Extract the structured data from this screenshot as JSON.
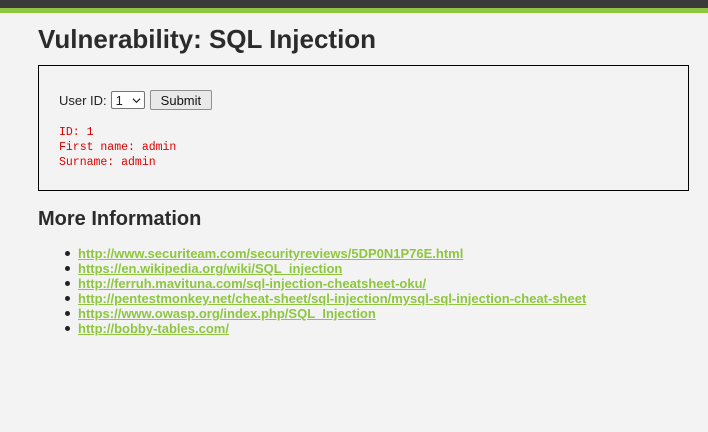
{
  "page": {
    "title": "Vulnerability: SQL Injection"
  },
  "form": {
    "user_id_label": "User ID:",
    "selected_value": "1",
    "submit_label": "Submit"
  },
  "result": {
    "id_line": "ID: 1",
    "first_name_line": "First name: admin",
    "surname_line": "Surname: admin"
  },
  "more_info": {
    "title": "More Information",
    "links": [
      "http://www.securiteam.com/securityreviews/5DP0N1P76E.html",
      "https://en.wikipedia.org/wiki/SQL_injection",
      "http://ferruh.mavituna.com/sql-injection-cheatsheet-oku/",
      "http://pentestmonkey.net/cheat-sheet/sql-injection/mysql-sql-injection-cheat-sheet",
      "https://www.owasp.org/index.php/SQL_Injection",
      "http://bobby-tables.com/"
    ]
  },
  "colors": {
    "header_dark": "#3a3a3a",
    "accent_green": "#8ec63f",
    "result_red": "#e00000",
    "background": "#f3f3f3"
  },
  "icons": {
    "select_arrow": "chevron-down-icon"
  }
}
